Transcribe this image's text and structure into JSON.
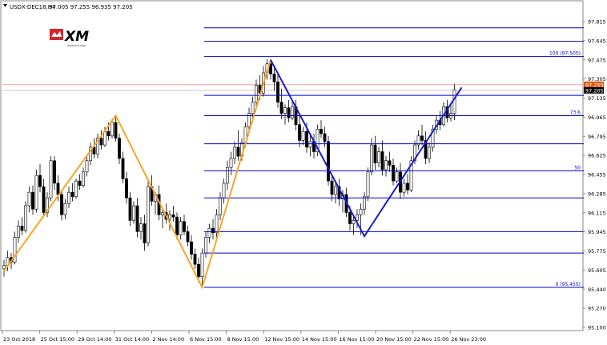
{
  "header": {
    "symbol": "USDX-DEC18,H4",
    "ohlc": "97.005 97.255 96.935 97.205"
  },
  "logo": {
    "brand": "XM",
    "tagline": "www.xm.com"
  },
  "colors": {
    "candle": "#000000",
    "zigzag": "#f5a623",
    "fib": "#0000cc",
    "pattern": "#1a1acc",
    "price_line": "#f4a0a0",
    "bid_tag": "#e05a10",
    "border": "#888888"
  },
  "chart_data": {
    "type": "candlestick",
    "instrument": "USDX-DEC18",
    "timeframe": "H4",
    "x_tick_labels": [
      "23 Oct 2018",
      "25 Oct 15:00",
      "29 Oct 14:00",
      "31 Oct 14:00",
      "2 Nov 14:00",
      "6 Nov 15:00",
      "8 Nov 15:00",
      "12 Nov 15:00",
      "14 Nov 15:00",
      "16 Nov 15:00",
      "20 Nov 15:00",
      "22 Nov 15:00",
      "26 Nov 23:00"
    ],
    "y_tick_labels": [
      "97.815",
      "97.645",
      "97.475",
      "97.305",
      "97.135",
      "96.965",
      "96.795",
      "96.625",
      "96.455",
      "96.285",
      "96.115",
      "95.945",
      "95.775",
      "95.605",
      "95.440",
      "95.270",
      "95.100"
    ],
    "ylim": [
      95.06,
      97.97
    ],
    "price_tags": {
      "ask": "97.255",
      "bid": "97.205"
    },
    "fib_levels": [
      {
        "price": 97.76
      },
      {
        "price": 97.64
      },
      {
        "price": 97.505,
        "label": "100  (97.505)"
      },
      {
        "price": 97.16
      },
      {
        "price": 96.98,
        "label": "73.6"
      },
      {
        "price": 96.73
      },
      {
        "price": 96.49,
        "label": "50"
      },
      {
        "price": 96.25
      },
      {
        "price": 95.95
      },
      {
        "price": 95.76
      },
      {
        "price": 95.455,
        "label": "0  (95.455)"
      }
    ],
    "zigzag": [
      {
        "i": 0,
        "price": 95.6
      },
      {
        "i": 31,
        "price": 96.98
      },
      {
        "i": 55,
        "price": 95.455
      },
      {
        "i": 74,
        "price": 97.475
      }
    ],
    "pattern": [
      {
        "i": 74,
        "price": 97.475
      },
      {
        "i": 100,
        "price": 95.91
      },
      {
        "i": 127,
        "price": 97.23
      }
    ],
    "candles": [
      [
        95.62,
        95.7,
        95.55,
        95.65
      ],
      [
        95.65,
        95.78,
        95.6,
        95.72
      ],
      [
        95.72,
        95.76,
        95.62,
        95.68
      ],
      [
        95.68,
        95.95,
        95.66,
        95.9
      ],
      [
        95.9,
        96.05,
        95.85,
        96.0
      ],
      [
        96.0,
        96.08,
        95.92,
        95.96
      ],
      [
        95.96,
        96.22,
        95.94,
        96.18
      ],
      [
        96.18,
        96.35,
        96.12,
        96.3
      ],
      [
        96.3,
        96.36,
        96.1,
        96.15
      ],
      [
        96.15,
        96.5,
        96.12,
        96.45
      ],
      [
        96.45,
        96.55,
        96.3,
        96.35
      ],
      [
        96.35,
        96.42,
        96.08,
        96.12
      ],
      [
        96.12,
        96.3,
        96.08,
        96.25
      ],
      [
        96.25,
        96.62,
        96.22,
        96.58
      ],
      [
        96.58,
        96.62,
        96.32,
        96.38
      ],
      [
        96.38,
        96.45,
        96.22,
        96.28
      ],
      [
        96.28,
        96.32,
        96.05,
        96.1
      ],
      [
        96.1,
        96.24,
        96.06,
        96.2
      ],
      [
        96.2,
        96.35,
        96.16,
        96.3
      ],
      [
        96.3,
        96.38,
        96.22,
        96.26
      ],
      [
        96.26,
        96.42,
        96.24,
        96.4
      ],
      [
        96.4,
        96.46,
        96.32,
        96.36
      ],
      [
        96.36,
        96.52,
        96.34,
        96.48
      ],
      [
        96.48,
        96.62,
        96.44,
        96.58
      ],
      [
        96.58,
        96.74,
        96.54,
        96.7
      ],
      [
        96.7,
        96.78,
        96.6,
        96.64
      ],
      [
        96.64,
        96.82,
        96.6,
        96.78
      ],
      [
        96.78,
        96.85,
        96.68,
        96.72
      ],
      [
        96.72,
        96.88,
        96.7,
        96.84
      ],
      [
        96.84,
        96.92,
        96.76,
        96.8
      ],
      [
        96.8,
        96.95,
        96.78,
        96.92
      ],
      [
        96.92,
        96.99,
        96.75,
        96.78
      ],
      [
        96.78,
        96.82,
        96.55,
        96.6
      ],
      [
        96.6,
        96.66,
        96.38,
        96.42
      ],
      [
        96.42,
        96.48,
        96.2,
        96.25
      ],
      [
        96.25,
        96.3,
        96.0,
        96.05
      ],
      [
        96.05,
        96.22,
        96.02,
        96.18
      ],
      [
        96.18,
        96.25,
        95.9,
        95.95
      ],
      [
        95.95,
        96.08,
        95.88,
        96.02
      ],
      [
        96.02,
        96.1,
        95.78,
        95.85
      ],
      [
        95.85,
        96.4,
        95.82,
        96.35
      ],
      [
        96.35,
        96.45,
        96.18,
        96.22
      ],
      [
        96.22,
        96.3,
        96.1,
        96.28
      ],
      [
        96.28,
        96.36,
        96.05,
        96.1
      ],
      [
        96.1,
        96.16,
        95.98,
        96.12
      ],
      [
        96.12,
        96.2,
        96.02,
        96.06
      ],
      [
        96.06,
        96.14,
        95.96,
        96.1
      ],
      [
        96.1,
        96.18,
        96.04,
        96.08
      ],
      [
        96.08,
        96.12,
        95.88,
        95.92
      ],
      [
        95.92,
        96.08,
        95.88,
        96.04
      ],
      [
        96.04,
        96.1,
        95.92,
        95.95
      ],
      [
        95.95,
        96.0,
        95.82,
        95.86
      ],
      [
        95.86,
        95.92,
        95.7,
        95.75
      ],
      [
        95.75,
        95.8,
        95.62,
        95.66
      ],
      [
        95.66,
        95.72,
        95.5,
        95.55
      ],
      [
        95.55,
        95.8,
        95.46,
        95.76
      ],
      [
        95.76,
        95.95,
        95.72,
        95.9
      ],
      [
        95.9,
        96.02,
        95.85,
        95.98
      ],
      [
        95.98,
        96.06,
        95.88,
        95.94
      ],
      [
        95.94,
        96.15,
        95.9,
        96.1
      ],
      [
        96.1,
        96.3,
        96.05,
        96.25
      ],
      [
        96.25,
        96.42,
        96.2,
        96.38
      ],
      [
        96.38,
        96.58,
        96.32,
        96.52
      ],
      [
        96.52,
        96.66,
        96.45,
        96.6
      ],
      [
        96.6,
        96.75,
        96.55,
        96.7
      ],
      [
        96.7,
        96.85,
        96.58,
        96.62
      ],
      [
        96.62,
        96.78,
        96.58,
        96.74
      ],
      [
        96.74,
        96.92,
        96.7,
        96.88
      ],
      [
        96.88,
        97.05,
        96.85,
        97.0
      ],
      [
        97.0,
        97.15,
        96.92,
        97.1
      ],
      [
        97.1,
        97.3,
        97.05,
        97.25
      ],
      [
        97.25,
        97.34,
        97.12,
        97.18
      ],
      [
        97.18,
        97.42,
        97.15,
        97.36
      ],
      [
        97.36,
        97.48,
        97.3,
        97.44
      ],
      [
        97.44,
        97.48,
        97.3,
        97.35
      ],
      [
        97.35,
        97.42,
        97.2,
        97.28
      ],
      [
        97.28,
        97.35,
        97.05,
        97.1
      ],
      [
        97.1,
        97.22,
        96.95,
        97.0
      ],
      [
        97.0,
        97.08,
        96.9,
        97.05
      ],
      [
        97.05,
        97.12,
        96.92,
        96.96
      ],
      [
        96.96,
        97.1,
        96.94,
        97.06
      ],
      [
        97.06,
        97.12,
        96.85,
        96.9
      ],
      [
        96.9,
        96.98,
        96.7,
        96.76
      ],
      [
        96.76,
        96.88,
        96.72,
        96.84
      ],
      [
        96.84,
        96.92,
        96.65,
        96.7
      ],
      [
        96.7,
        96.8,
        96.62,
        96.75
      ],
      [
        96.75,
        96.82,
        96.6,
        96.66
      ],
      [
        96.66,
        96.9,
        96.62,
        96.86
      ],
      [
        96.86,
        96.94,
        96.78,
        96.82
      ],
      [
        96.82,
        96.88,
        96.7,
        96.75
      ],
      [
        96.75,
        96.8,
        96.36,
        96.4
      ],
      [
        96.4,
        96.46,
        96.22,
        96.28
      ],
      [
        96.28,
        96.4,
        96.2,
        96.35
      ],
      [
        96.35,
        96.42,
        96.18,
        96.24
      ],
      [
        96.24,
        96.32,
        96.12,
        96.28
      ],
      [
        96.28,
        96.34,
        96.08,
        96.12
      ],
      [
        96.12,
        96.18,
        95.96,
        96.02
      ],
      [
        96.02,
        96.08,
        95.92,
        96.05
      ],
      [
        96.05,
        96.15,
        95.98,
        96.1
      ],
      [
        96.1,
        96.2,
        95.92,
        96.15
      ],
      [
        96.15,
        96.3,
        96.1,
        96.26
      ],
      [
        96.26,
        96.52,
        96.22,
        96.48
      ],
      [
        96.48,
        96.78,
        96.45,
        96.72
      ],
      [
        96.72,
        96.8,
        96.5,
        96.56
      ],
      [
        96.56,
        96.7,
        96.52,
        96.66
      ],
      [
        96.66,
        96.76,
        96.45,
        96.5
      ],
      [
        96.5,
        96.62,
        96.44,
        96.58
      ],
      [
        96.58,
        96.66,
        96.48,
        96.54
      ],
      [
        96.54,
        96.6,
        96.36,
        96.4
      ],
      [
        96.4,
        96.52,
        96.38,
        96.48
      ],
      [
        96.48,
        96.56,
        96.24,
        96.3
      ],
      [
        96.3,
        96.42,
        96.26,
        96.38
      ],
      [
        96.38,
        96.46,
        96.28,
        96.32
      ],
      [
        96.32,
        96.62,
        96.3,
        96.58
      ],
      [
        96.58,
        96.76,
        96.55,
        96.72
      ],
      [
        96.72,
        96.85,
        96.68,
        96.8
      ],
      [
        96.8,
        96.9,
        96.72,
        96.76
      ],
      [
        96.76,
        96.84,
        96.55,
        96.6
      ],
      [
        96.6,
        96.74,
        96.56,
        96.7
      ],
      [
        96.7,
        96.9,
        96.66,
        96.86
      ],
      [
        96.86,
        96.98,
        96.82,
        96.94
      ],
      [
        96.94,
        97.02,
        96.85,
        96.9
      ],
      [
        96.9,
        97.1,
        96.88,
        97.06
      ],
      [
        97.06,
        97.12,
        96.92,
        96.96
      ],
      [
        96.96,
        97.08,
        96.93,
        97.0
      ],
      [
        97.0,
        97.26,
        96.94,
        97.21
      ]
    ]
  }
}
